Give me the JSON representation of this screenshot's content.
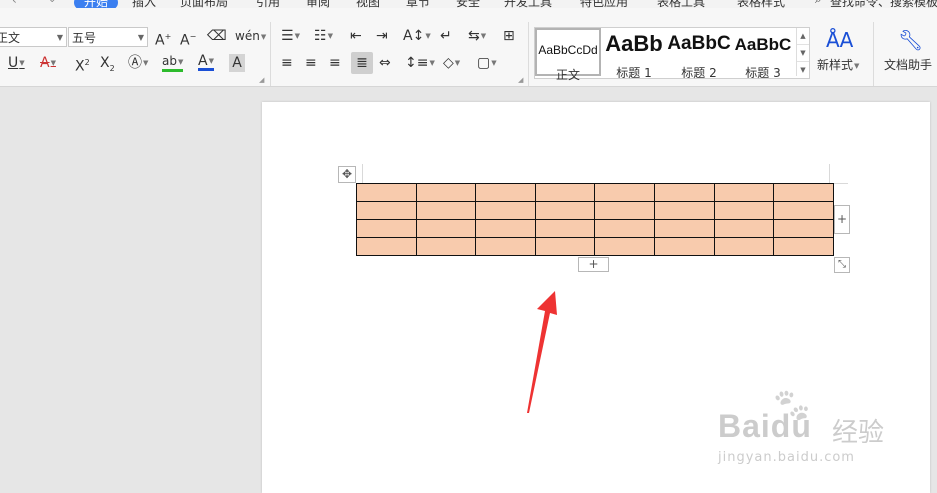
{
  "menu": {
    "tabs": [
      "开始",
      "插入",
      "页面布局",
      "引用",
      "审阅",
      "视图",
      "章节",
      "安全",
      "开发工具",
      "特色应用",
      "表格工具",
      "表格样式"
    ],
    "active": "开始",
    "search": "查找命令、搜索模板"
  },
  "font": {
    "name": "正文",
    "size": "五号"
  },
  "styles": [
    {
      "preview": "AaBbCcDd",
      "name": "正文"
    },
    {
      "preview": "AaBb",
      "name": "标题 1"
    },
    {
      "preview": "AaBbC",
      "name": "标题 2"
    },
    {
      "preview": "AaBbC",
      "name": "标题 3"
    }
  ],
  "toolbar": {
    "new_style": "新样式",
    "doc_helper": "文档助手"
  },
  "table": {
    "rows": 4,
    "cols": 8,
    "fill_color": "#f8cbad",
    "border_color": "#111111"
  },
  "handles": {
    "add_column": "+",
    "add_row": "+",
    "move": "✥",
    "resize": "⤡"
  },
  "annotation": {
    "arrow_color": "#ee3333"
  },
  "watermark": {
    "brand": "Baidu",
    "brand_cn": "经验",
    "url": "jingyan.baidu.com"
  }
}
